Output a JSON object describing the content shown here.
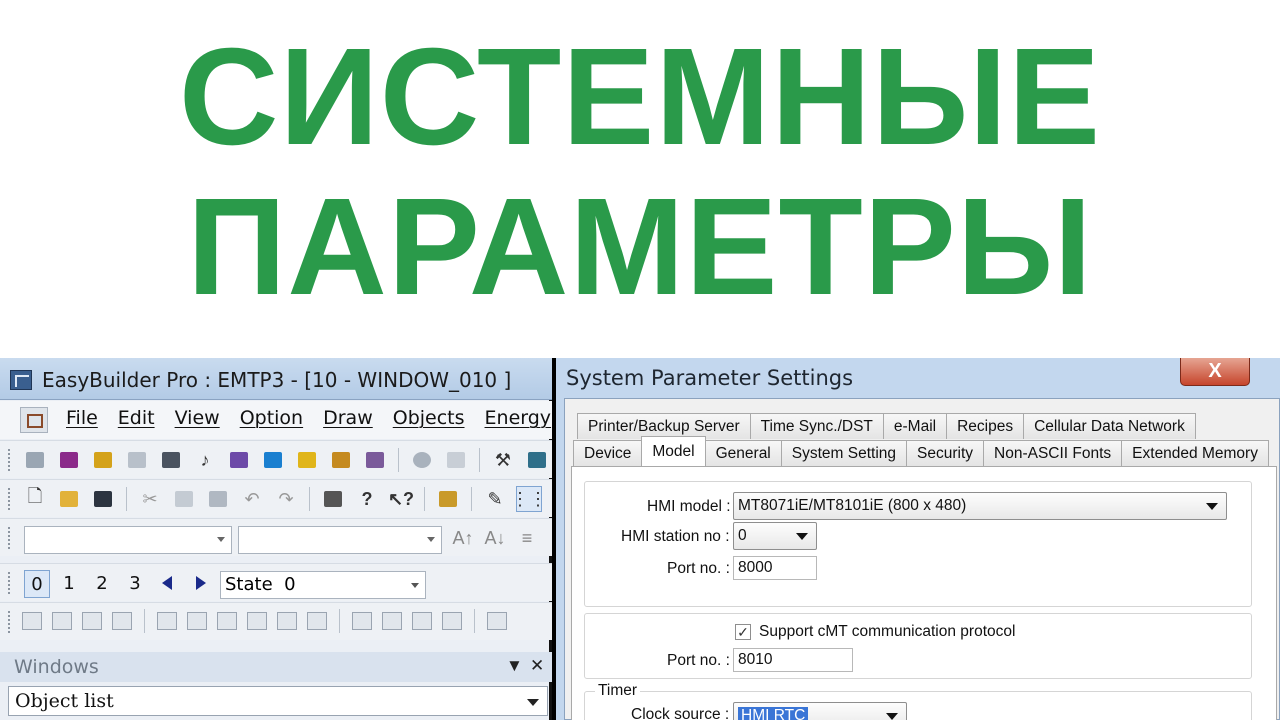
{
  "headline": {
    "line1": "СИСТЕМНЫЕ",
    "line2": "ПАРАМЕТРЫ"
  },
  "app": {
    "title": "EasyBuilder Pro : EMTP3 - [10 - WINDOW_010 ]",
    "menu": [
      "File",
      "Edit",
      "View",
      "Option",
      "Draw",
      "Objects",
      "Energy"
    ],
    "pages": [
      "0",
      "1",
      "2",
      "3"
    ],
    "state_label": "State  0",
    "windows_panel_title": "Windows",
    "object_list_label": "Object list"
  },
  "dialog": {
    "title": "System Parameter Settings",
    "close_label": "X",
    "tabs_row1": [
      "Printer/Backup Server",
      "Time Sync./DST",
      "e-Mail",
      "Recipes",
      "Cellular Data Network"
    ],
    "tabs_row2": [
      "Device",
      "Model",
      "General",
      "System Setting",
      "Security",
      "Non-ASCII Fonts",
      "Extended Memory"
    ],
    "active_tab": "Model",
    "hmi_model_label": "HMI model :",
    "hmi_model_value": "MT8071iE/MT8101iE (800 x 480)",
    "hmi_station_label": "HMI station no :",
    "hmi_station_value": "0",
    "port_label": "Port no. :",
    "port_value": "8000",
    "cmt_checkbox_label": "Support cMT communication protocol",
    "cmt_checked": true,
    "cmt_port_label": "Port no. :",
    "cmt_port_value": "8010",
    "timer_group_label": "Timer",
    "clock_source_label": "Clock source :",
    "clock_source_value": "HMI RTC"
  },
  "colors": {
    "headline": "#2a9a4a",
    "titlebar": "#c3d7ee",
    "close": "#c6452c"
  }
}
